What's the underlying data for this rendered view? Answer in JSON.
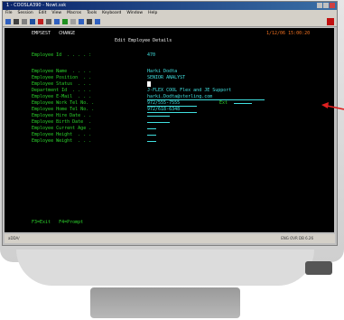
{
  "window": {
    "title": "1 - COOSLA390 - Nowt.ssk",
    "menu": [
      "File",
      "Session",
      "Edit",
      "View",
      "Macros",
      "Tools",
      "Keyboard",
      "Window",
      "Help"
    ]
  },
  "terminal": {
    "top_left": "EMPSEST   CHANGE",
    "top_right": "1/12/06 15:00:20",
    "heading": "Edit Employee Details",
    "employee_id_label": "Employee Id  . . . . :",
    "employee_id_value": "470",
    "fields": [
      {
        "label": "Employee Name  . . . .",
        "value": "Harki Dodta"
      },
      {
        "label": "Employee Position  . .",
        "value": "SENIOR ANALYST"
      },
      {
        "label": "Employee Status  . . .",
        "value": ""
      },
      {
        "label": "Department Id  . . . .",
        "value": "J-FLEX COOL Flex and JE Support"
      },
      {
        "label": "Employee E-Mail  . . .",
        "value": "harki.Dodta@sterling.com"
      },
      {
        "label": "Employee Work Tel No. .",
        "value": "972/555-7555",
        "ext_label": "Ext",
        "ext_value": ""
      },
      {
        "label": "Employee Home Tel No. .",
        "value": "972/618-6348"
      },
      {
        "label": "Employee Hire Date . .",
        "value": ""
      },
      {
        "label": "Employee Birth Date  .",
        "value": ""
      },
      {
        "label": "Employee Current Age .",
        "value": ""
      },
      {
        "label": "Employee Height  . . .",
        "value": ""
      },
      {
        "label": "Employee Weight  . . .",
        "value": ""
      }
    ],
    "function_keys": "F3=Exit   F4=Prompt"
  },
  "statusbar": {
    "left": "aDDA/",
    "right": "ENG  OVR  DB 6.26"
  },
  "colors": {
    "terminal_bg": "#000000",
    "label_green": "#2bd42b",
    "value_cyan": "#40e0e0",
    "arrow_red": "#e02020"
  }
}
